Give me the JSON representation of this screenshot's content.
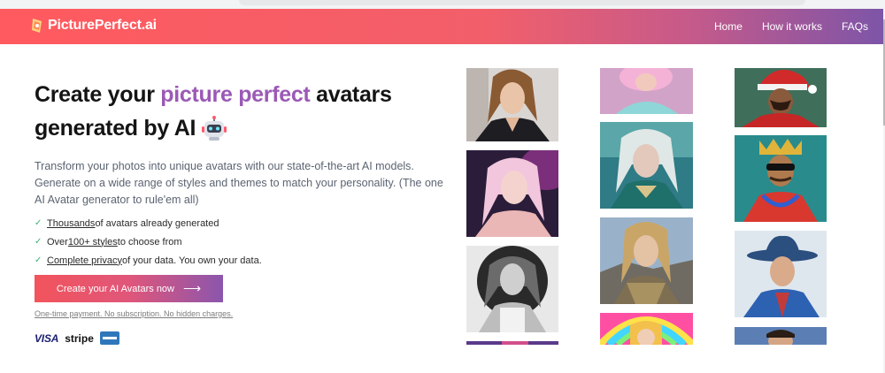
{
  "header": {
    "logo_text": "PicturePerfect.ai",
    "nav": [
      {
        "label": "Home"
      },
      {
        "label": "How it works"
      },
      {
        "label": "FAQs"
      }
    ]
  },
  "hero": {
    "headline_part1": "Create your ",
    "headline_highlight": "picture perfect",
    "headline_part2": " avatars generated by AI",
    "description": "Transform your photos into unique avatars with our state-of-the-art AI models. Generate on a wide range of styles and themes to match your personality. (The one AI Avatar generator to rule'em all)",
    "features": [
      {
        "link": "Thousands",
        "text": " of avatars already generated"
      },
      {
        "prefix": "Over ",
        "link": "100+ styles",
        "text": " to choose from"
      },
      {
        "link": "Complete privacy",
        "text": " of your data. You own your data."
      }
    ],
    "cta_label": "Create your AI Avatars now",
    "note": "One-time payment. No subscription. No hidden charges.",
    "payments": {
      "visa": "VISA",
      "stripe": "stripe",
      "amex_icon": "amex-card-icon"
    }
  },
  "colors": {
    "header_start": "#ff5a5f",
    "header_end": "#7d55a8",
    "highlight": "#9b59b6",
    "check": "#3bb273"
  }
}
